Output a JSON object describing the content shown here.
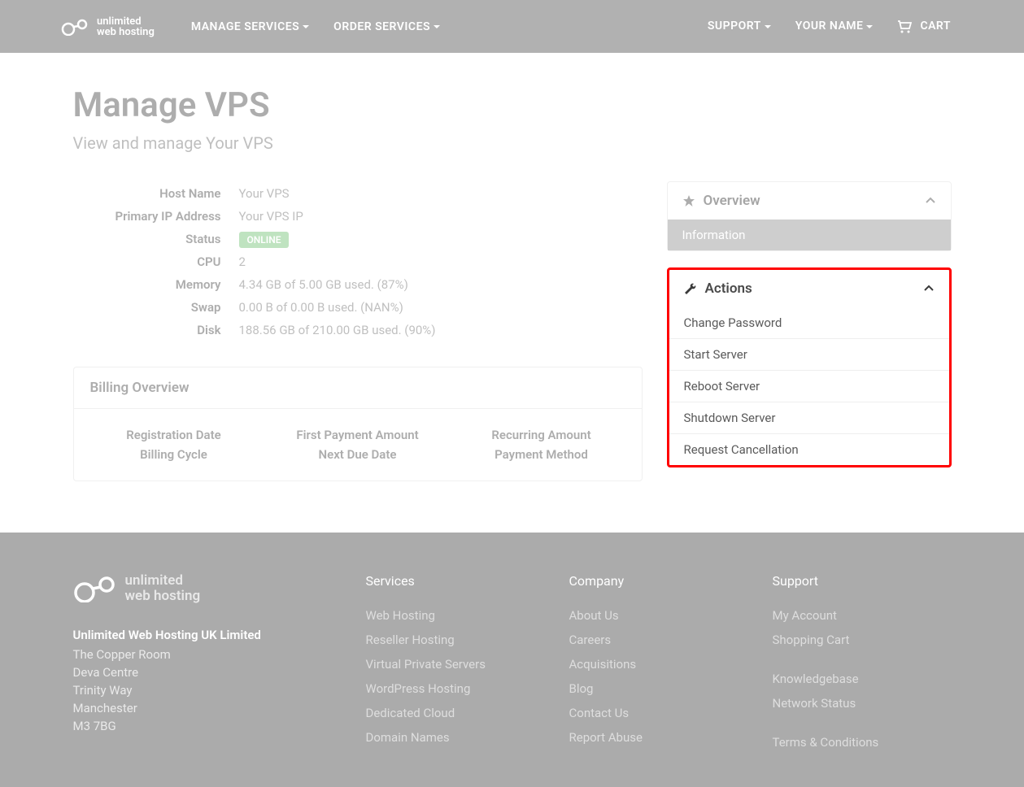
{
  "brand": {
    "line1": "unlimited",
    "line2": "web hosting"
  },
  "nav": {
    "manage_services": "MANAGE SERVICES",
    "order_services": "ORDER SERVICES",
    "support": "SUPPORT",
    "your_name": "YOUR NAME",
    "cart": "CART"
  },
  "page": {
    "title": "Manage VPS",
    "subtitle": "View and manage Your VPS"
  },
  "details": {
    "labels": {
      "host_name": "Host Name",
      "primary_ip": "Primary IP Address",
      "status": "Status",
      "cpu": "CPU",
      "memory": "Memory",
      "swap": "Swap",
      "disk": "Disk"
    },
    "values": {
      "host_name": "Your VPS",
      "primary_ip": "Your VPS IP",
      "status_badge": "ONLINE",
      "cpu": "2",
      "memory": "4.34 GB of 5.00 GB used. (87%)",
      "swap": "0.00 B of 0.00 B used. (NAN%)",
      "disk": "188.56 GB of 210.00 GB used. (90%)"
    }
  },
  "billing": {
    "header": "Billing Overview",
    "col1a": "Registration Date",
    "col1b": "Billing Cycle",
    "col2a": "First Payment Amount",
    "col2b": "Next Due Date",
    "col3a": "Recurring Amount",
    "col3b": "Payment Method"
  },
  "sidebar": {
    "overview": {
      "title": "Overview",
      "information": "Information"
    },
    "actions": {
      "title": "Actions",
      "items": [
        "Change Password",
        "Start Server",
        "Reboot Server",
        "Shutdown Server",
        "Request Cancellation"
      ]
    }
  },
  "footer": {
    "company_name": "Unlimited Web Hosting UK Limited",
    "address": [
      "The Copper Room",
      "Deva Centre",
      "Trinity Way",
      "Manchester",
      "M3 7BG"
    ],
    "col_services": {
      "heading": "Services",
      "links": [
        "Web Hosting",
        "Reseller Hosting",
        "Virtual Private Servers",
        "WordPress Hosting",
        "Dedicated Cloud",
        "Domain Names"
      ]
    },
    "col_company": {
      "heading": "Company",
      "links": [
        "About Us",
        "Careers",
        "Acquisitions",
        "Blog",
        "Contact Us",
        "Report Abuse"
      ]
    },
    "col_support": {
      "heading": "Support",
      "group1": [
        "My Account",
        "Shopping Cart"
      ],
      "group2": [
        "Knowledgebase",
        "Network Status"
      ],
      "group3": [
        "Terms & Conditions"
      ]
    }
  }
}
